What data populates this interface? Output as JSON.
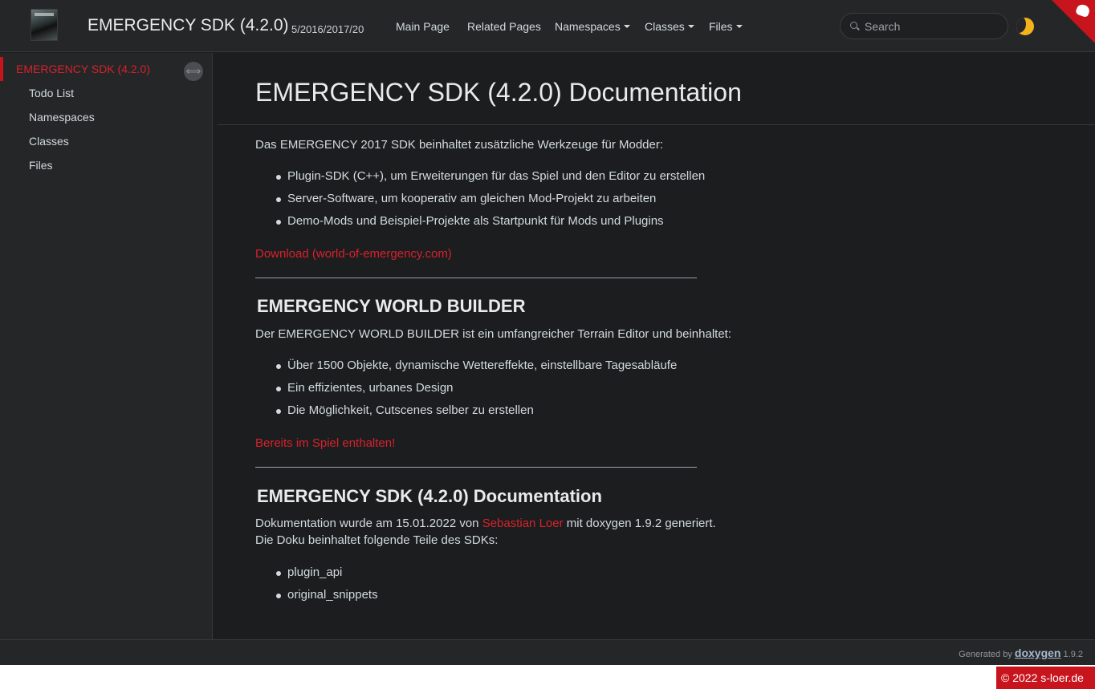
{
  "header": {
    "project_name": "EMERGENCY SDK (4.2.0)",
    "project_number": "5/2016/2017/20",
    "nav": {
      "main_page": "Main Page",
      "related_pages": "Related Pages",
      "namespaces": "Namespaces",
      "classes": "Classes",
      "files": "Files"
    },
    "search_placeholder": "Search"
  },
  "sidebar": {
    "items": [
      {
        "label": "EMERGENCY SDK (4.2.0)"
      },
      {
        "label": "Todo List"
      },
      {
        "label": "Namespaces"
      },
      {
        "label": "Classes"
      },
      {
        "label": "Files"
      }
    ]
  },
  "content": {
    "title": "EMERGENCY SDK (4.2.0) Documentation",
    "sdk_intro": "Das EMERGENCY 2017 SDK beinhaltet zusätzliche Werkzeuge für Modder:",
    "sdk_items": [
      "Plugin-SDK (C++), um Erweiterungen für das Spiel und den Editor zu erstellen",
      "Server-Software, um kooperativ am gleichen Mod-Projekt zu arbeiten",
      "Demo-Mods und Beispiel-Projekte als Startpunkt für Mods und Plugins"
    ],
    "download_link": "Download (world-of-emergency.com)",
    "wb_heading": "EMERGENCY WORLD BUILDER",
    "wb_intro": "Der EMERGENCY WORLD BUILDER ist ein umfangreicher Terrain Editor und beinhaltet:",
    "wb_items": [
      "Über 1500 Objekte, dynamische Wettereffekte, einstellbare Tagesabläufe",
      "Ein effizientes, urbanes Design",
      "Die Möglichkeit, Cutscenes selber zu erstellen"
    ],
    "wb_link": "Bereits im Spiel enthalten!",
    "doc_heading": "EMERGENCY SDK (4.2.0) Documentation",
    "doc_text_pre": "Dokumentation wurde am 15.01.2022 von ",
    "doc_author": "Sebastian Loer",
    "doc_text_post": " mit doxygen 1.9.2 generiert.",
    "doc_text_line2": "Die Doku beinhaltet folgende Teile des SDKs:",
    "doc_items": [
      "plugin_api",
      "original_snippets"
    ]
  },
  "footer": {
    "generated_by": "Generated by",
    "doxygen": "doxygen",
    "version": "1.9.2",
    "copyright": "© 2022 s-loer.de"
  },
  "colors": {
    "accent": "#c8141c",
    "link": "#d6222b",
    "bg": "#1c1d1f",
    "panel": "#252628"
  },
  "icons": {
    "logo": "game-cover-logo",
    "search": "search-icon",
    "darkmode": "moon-icon",
    "corner": "github-corner-icon",
    "sync": "sync-arrows-icon"
  }
}
